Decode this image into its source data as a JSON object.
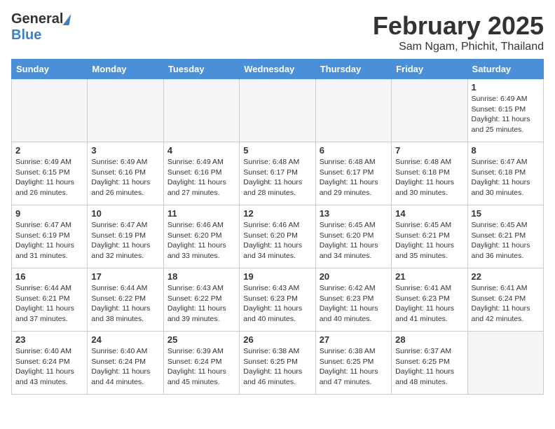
{
  "header": {
    "logo_general": "General",
    "logo_blue": "Blue",
    "month_title": "February 2025",
    "location": "Sam Ngam, Phichit, Thailand"
  },
  "weekdays": [
    "Sunday",
    "Monday",
    "Tuesday",
    "Wednesday",
    "Thursday",
    "Friday",
    "Saturday"
  ],
  "weeks": [
    [
      {
        "day": "",
        "info": ""
      },
      {
        "day": "",
        "info": ""
      },
      {
        "day": "",
        "info": ""
      },
      {
        "day": "",
        "info": ""
      },
      {
        "day": "",
        "info": ""
      },
      {
        "day": "",
        "info": ""
      },
      {
        "day": "1",
        "info": "Sunrise: 6:49 AM\nSunset: 6:15 PM\nDaylight: 11 hours and 25 minutes."
      }
    ],
    [
      {
        "day": "2",
        "info": "Sunrise: 6:49 AM\nSunset: 6:15 PM\nDaylight: 11 hours and 26 minutes."
      },
      {
        "day": "3",
        "info": "Sunrise: 6:49 AM\nSunset: 6:16 PM\nDaylight: 11 hours and 26 minutes."
      },
      {
        "day": "4",
        "info": "Sunrise: 6:49 AM\nSunset: 6:16 PM\nDaylight: 11 hours and 27 minutes."
      },
      {
        "day": "5",
        "info": "Sunrise: 6:48 AM\nSunset: 6:17 PM\nDaylight: 11 hours and 28 minutes."
      },
      {
        "day": "6",
        "info": "Sunrise: 6:48 AM\nSunset: 6:17 PM\nDaylight: 11 hours and 29 minutes."
      },
      {
        "day": "7",
        "info": "Sunrise: 6:48 AM\nSunset: 6:18 PM\nDaylight: 11 hours and 30 minutes."
      },
      {
        "day": "8",
        "info": "Sunrise: 6:47 AM\nSunset: 6:18 PM\nDaylight: 11 hours and 30 minutes."
      }
    ],
    [
      {
        "day": "9",
        "info": "Sunrise: 6:47 AM\nSunset: 6:19 PM\nDaylight: 11 hours and 31 minutes."
      },
      {
        "day": "10",
        "info": "Sunrise: 6:47 AM\nSunset: 6:19 PM\nDaylight: 11 hours and 32 minutes."
      },
      {
        "day": "11",
        "info": "Sunrise: 6:46 AM\nSunset: 6:20 PM\nDaylight: 11 hours and 33 minutes."
      },
      {
        "day": "12",
        "info": "Sunrise: 6:46 AM\nSunset: 6:20 PM\nDaylight: 11 hours and 34 minutes."
      },
      {
        "day": "13",
        "info": "Sunrise: 6:45 AM\nSunset: 6:20 PM\nDaylight: 11 hours and 34 minutes."
      },
      {
        "day": "14",
        "info": "Sunrise: 6:45 AM\nSunset: 6:21 PM\nDaylight: 11 hours and 35 minutes."
      },
      {
        "day": "15",
        "info": "Sunrise: 6:45 AM\nSunset: 6:21 PM\nDaylight: 11 hours and 36 minutes."
      }
    ],
    [
      {
        "day": "16",
        "info": "Sunrise: 6:44 AM\nSunset: 6:21 PM\nDaylight: 11 hours and 37 minutes."
      },
      {
        "day": "17",
        "info": "Sunrise: 6:44 AM\nSunset: 6:22 PM\nDaylight: 11 hours and 38 minutes."
      },
      {
        "day": "18",
        "info": "Sunrise: 6:43 AM\nSunset: 6:22 PM\nDaylight: 11 hours and 39 minutes."
      },
      {
        "day": "19",
        "info": "Sunrise: 6:43 AM\nSunset: 6:23 PM\nDaylight: 11 hours and 40 minutes."
      },
      {
        "day": "20",
        "info": "Sunrise: 6:42 AM\nSunset: 6:23 PM\nDaylight: 11 hours and 40 minutes."
      },
      {
        "day": "21",
        "info": "Sunrise: 6:41 AM\nSunset: 6:23 PM\nDaylight: 11 hours and 41 minutes."
      },
      {
        "day": "22",
        "info": "Sunrise: 6:41 AM\nSunset: 6:24 PM\nDaylight: 11 hours and 42 minutes."
      }
    ],
    [
      {
        "day": "23",
        "info": "Sunrise: 6:40 AM\nSunset: 6:24 PM\nDaylight: 11 hours and 43 minutes."
      },
      {
        "day": "24",
        "info": "Sunrise: 6:40 AM\nSunset: 6:24 PM\nDaylight: 11 hours and 44 minutes."
      },
      {
        "day": "25",
        "info": "Sunrise: 6:39 AM\nSunset: 6:24 PM\nDaylight: 11 hours and 45 minutes."
      },
      {
        "day": "26",
        "info": "Sunrise: 6:38 AM\nSunset: 6:25 PM\nDaylight: 11 hours and 46 minutes."
      },
      {
        "day": "27",
        "info": "Sunrise: 6:38 AM\nSunset: 6:25 PM\nDaylight: 11 hours and 47 minutes."
      },
      {
        "day": "28",
        "info": "Sunrise: 6:37 AM\nSunset: 6:25 PM\nDaylight: 11 hours and 48 minutes."
      },
      {
        "day": "",
        "info": ""
      }
    ]
  ]
}
